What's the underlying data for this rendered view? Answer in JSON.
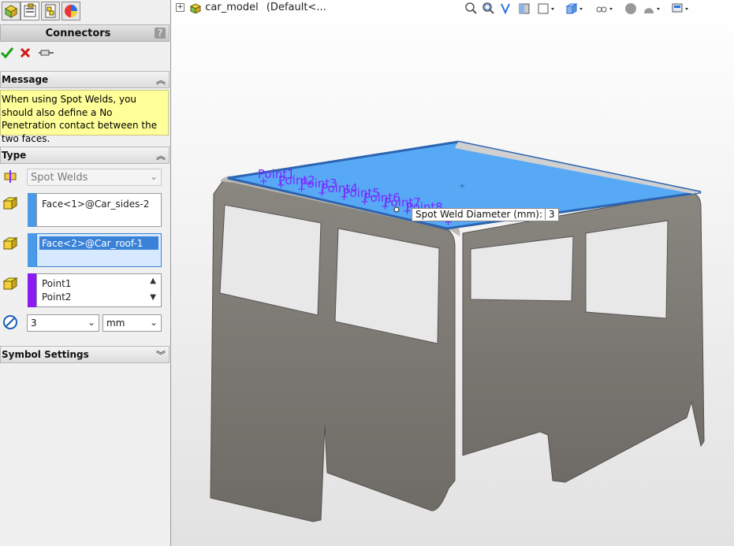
{
  "panel": {
    "title": "Connectors",
    "help": "?",
    "tabs": [
      "feature-manager-icon",
      "property-manager-icon",
      "configuration-manager-icon",
      "display-manager-icon"
    ]
  },
  "message": {
    "header": "Message",
    "text": "When using Spot Welds, you should also define a No Penetration contact between the two faces."
  },
  "type": {
    "header": "Type",
    "connector_type": "Spot Welds",
    "face1": "Face<1>@Car_sides-2",
    "face2": "Face<2>@Car_roof-1",
    "points": [
      "Point1",
      "Point2"
    ],
    "diameter": "3",
    "unit": "mm"
  },
  "symbol_settings": {
    "header": "Symbol Settings"
  },
  "tree": {
    "model": "car_model",
    "config": "(Default<..."
  },
  "tooltip": {
    "label": "Spot Weld Diameter (mm):",
    "value": "3"
  },
  "colors": {
    "roof": "#57a9f5",
    "body": "#767676",
    "selection": "#3a82d8",
    "message_bg": "#ffff99",
    "points": "#7a2aff"
  }
}
